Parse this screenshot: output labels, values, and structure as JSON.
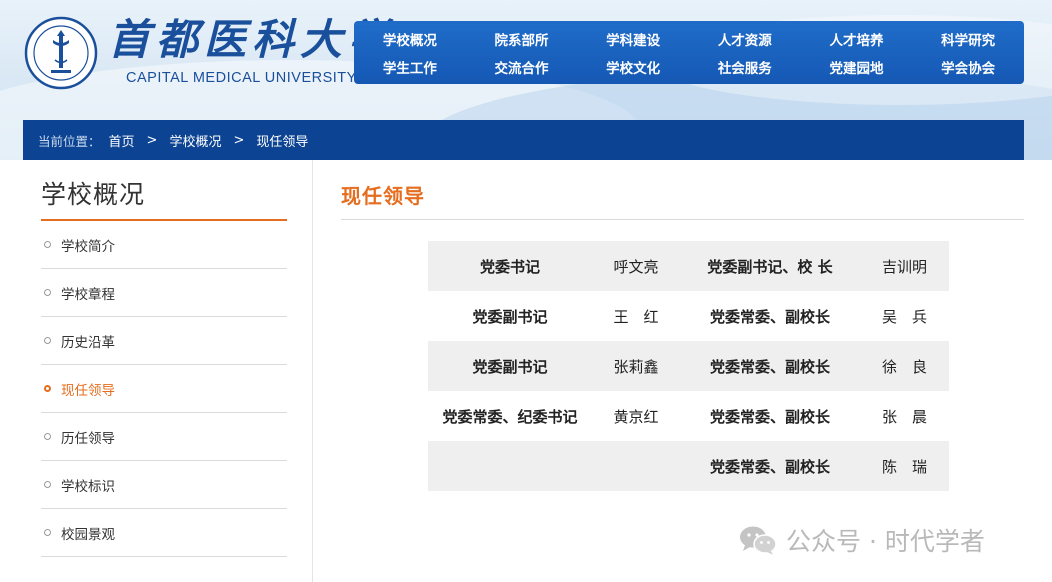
{
  "header": {
    "logo_cn": "首都医科大学",
    "logo_en": "CAPITAL MEDICAL UNIVERSITY",
    "nav": [
      [
        "学校概况",
        "院系部所",
        "学科建设",
        "人才资源",
        "人才培养",
        "科学研究"
      ],
      [
        "学生工作",
        "交流合作",
        "学校文化",
        "社会服务",
        "党建园地",
        "学会协会"
      ]
    ]
  },
  "breadcrumb": {
    "lead": "当前位置：",
    "items": [
      "首页",
      "学校概况",
      "现任领导"
    ],
    "separator": ">"
  },
  "sidebar": {
    "title": "学校概况",
    "items": [
      {
        "label": "学校简介",
        "active": false
      },
      {
        "label": "学校章程",
        "active": false
      },
      {
        "label": "历史沿革",
        "active": false
      },
      {
        "label": "现任领导",
        "active": true
      },
      {
        "label": "历任领导",
        "active": false
      },
      {
        "label": "学校标识",
        "active": false
      },
      {
        "label": "校园景观",
        "active": false
      }
    ]
  },
  "main": {
    "title": "现任领导",
    "leaders": [
      {
        "role1": "党委书记",
        "name1": "呼文亮",
        "role2": "党委副书记、校 长",
        "name2": "吉训明"
      },
      {
        "role1": "党委副书记",
        "name1": "王　红",
        "role2": "党委常委、副校长",
        "name2": "吴　兵"
      },
      {
        "role1": "党委副书记",
        "name1": "张莉鑫",
        "role2": "党委常委、副校长",
        "name2": "徐　良"
      },
      {
        "role1": "党委常委、纪委书记",
        "name1": "黄京红",
        "role2": "党委常委、副校长",
        "name2": "张　晨"
      },
      {
        "role1": "",
        "name1": "",
        "role2": "党委常委、副校长",
        "name2": "陈　瑞"
      }
    ]
  },
  "watermark": {
    "text": "公众号 · 时代学者",
    "icon": "wechat-icon"
  },
  "colors": {
    "brand_blue": "#1a4f9c",
    "nav_blue": "#1558b4",
    "breadcrumb_blue": "#0c4493",
    "accent_orange": "#e56d1f",
    "row_gray": "#efefef"
  }
}
